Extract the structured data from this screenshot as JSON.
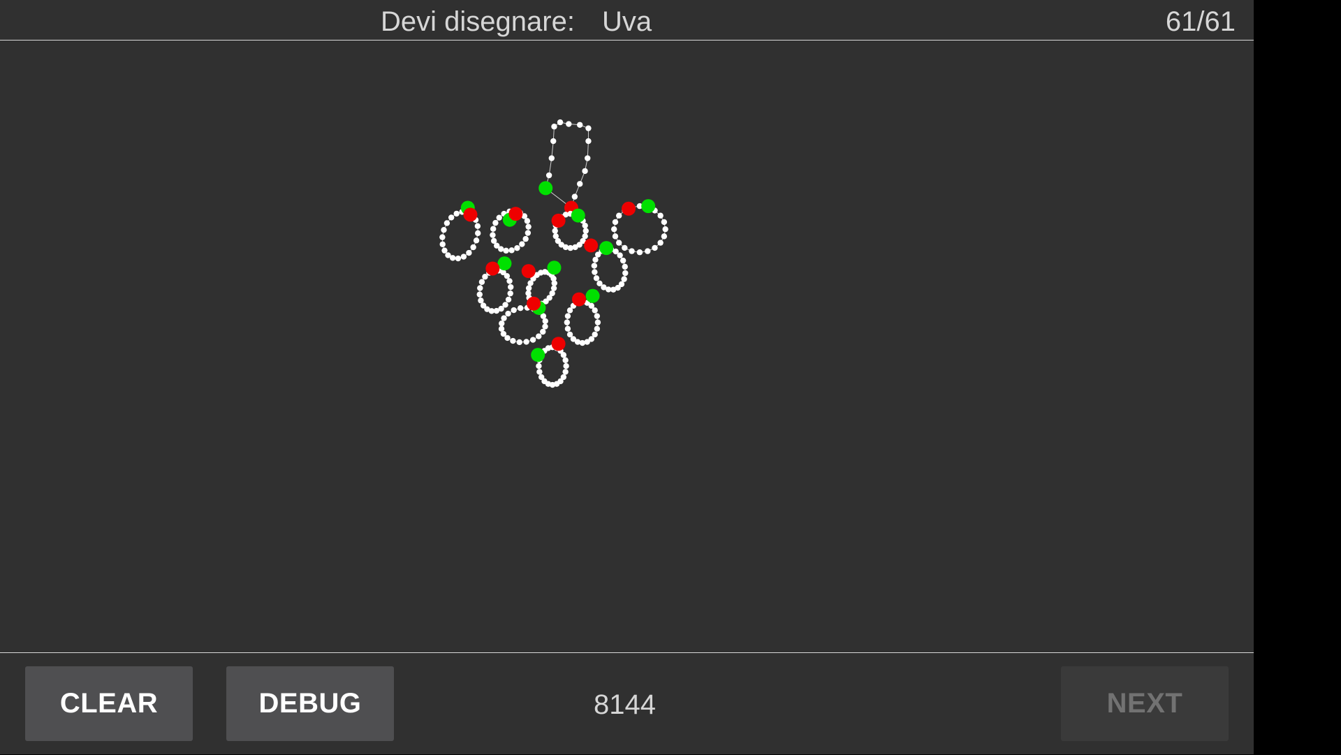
{
  "header": {
    "prompt_label": "Devi disegnare:",
    "prompt_word": "Uva",
    "counter": "61/61"
  },
  "footer": {
    "clear_label": "CLEAR",
    "debug_label": "DEBUG",
    "score": "8144",
    "next_label": "NEXT"
  },
  "colors": {
    "background": "#303030",
    "stroke_point": "#ffffff",
    "stroke_start": "#00e000",
    "stroke_end": "#ee0000",
    "button": "#4f4f51",
    "button_disabled": "#3a3a3a"
  }
}
